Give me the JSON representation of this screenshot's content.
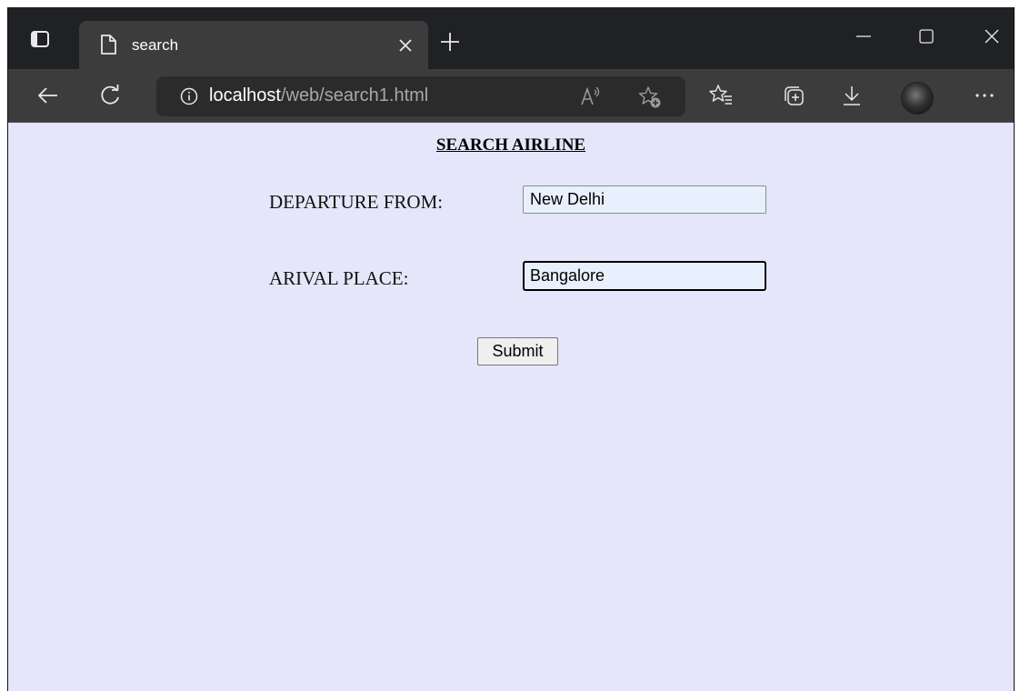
{
  "browser": {
    "tab": {
      "title": "search"
    },
    "address_bar": {
      "host": "localhost",
      "path": "/web/search1.html"
    },
    "icons": {
      "tab_actions": "tab-actions-icon",
      "page": "page-icon",
      "tab_close": "close-icon",
      "new_tab": "plus-icon",
      "minimize": "minimize-icon",
      "maximize": "maximize-icon",
      "close_window": "close-window-icon",
      "back": "back-arrow-icon",
      "refresh": "refresh-icon",
      "info": "info-icon",
      "read_aloud": "read-aloud-icon",
      "add_favorite": "add-favorite-icon",
      "favorites": "favorites-icon",
      "collections": "collections-icon",
      "downloads": "download-icon",
      "profile": "avatar",
      "more": "more-icon"
    },
    "colors": {
      "tabstrip": "#202124",
      "toolbar": "#3c3c3c",
      "address_bar": "#2b2b2b"
    }
  },
  "page": {
    "title": "SEARCH AIRLINE",
    "background": "#e6e6fa",
    "form": {
      "departure": {
        "label": "DEPARTURE FROM:",
        "value": "New Delhi"
      },
      "arrival": {
        "label": "ARIVAL PLACE:",
        "value": "Bangalore"
      },
      "submit_label": "Submit"
    }
  }
}
